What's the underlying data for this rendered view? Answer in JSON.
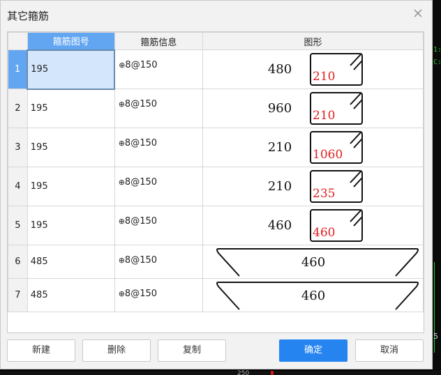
{
  "window": {
    "title": "其它箍筋"
  },
  "table": {
    "headers": [
      "箍筋图号",
      "箍筋信息",
      "图形"
    ],
    "rows": [
      {
        "num": "1",
        "code": "195",
        "bar_symbol": "⊕",
        "info": "8@150",
        "length": "480",
        "width": "210"
      },
      {
        "num": "2",
        "code": "195",
        "bar_symbol": "⊕",
        "info": "8@150",
        "length": "960",
        "width": "210"
      },
      {
        "num": "3",
        "code": "195",
        "bar_symbol": "⊕",
        "info": "8@150",
        "length": "210",
        "width": "1060"
      },
      {
        "num": "4",
        "code": "195",
        "bar_symbol": "⊕",
        "info": "8@150",
        "length": "210",
        "width": "235"
      },
      {
        "num": "5",
        "code": "195",
        "bar_symbol": "⊕",
        "info": "8@150",
        "length": "460",
        "width": "460"
      },
      {
        "num": "6",
        "code": "485",
        "bar_symbol": "⊕",
        "info": "8@150",
        "length": "460"
      },
      {
        "num": "7",
        "code": "485",
        "bar_symbol": "⊕",
        "info": "8@150",
        "length": "460"
      }
    ]
  },
  "buttons": {
    "new": "新建",
    "delete": "删除",
    "copy": "复制",
    "ok": "确定",
    "cancel": "取消"
  },
  "background": {
    "text_1": "1:",
    "text_2": "C:",
    "text_3": "5",
    "text_4": "250"
  },
  "colors": {
    "accent": "#2684f0",
    "header_active": "#62a6f2",
    "selected_cell": "#d3e6fb",
    "shape_dim": "#e02020"
  },
  "icons": {
    "close": "close-icon"
  }
}
